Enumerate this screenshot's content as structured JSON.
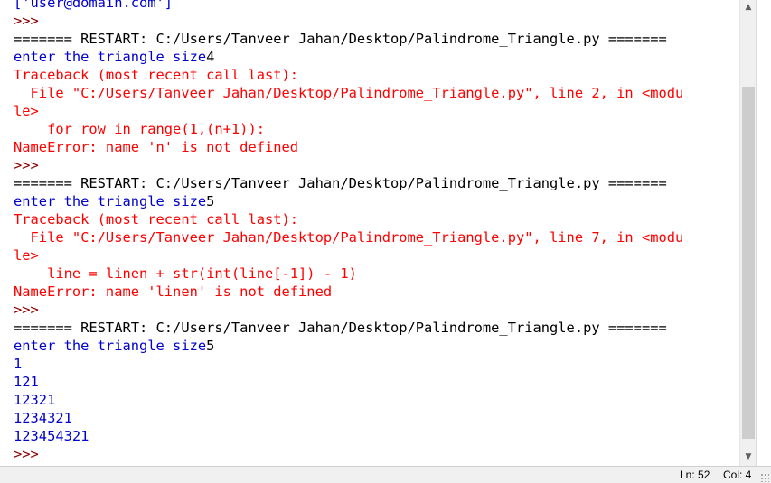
{
  "shell": {
    "lines": [
      [
        {
          "t": "['user@domain.com']",
          "k": "stdout"
        }
      ],
      [
        {
          "t": ">>> ",
          "k": "prompt"
        }
      ],
      [
        {
          "t": "======= RESTART: C:/Users/Tanveer Jahan/Desktop/Palindrome_Triangle.py =======",
          "k": "restart"
        }
      ],
      [
        {
          "t": "enter the triangle size",
          "k": "prompt-text"
        },
        {
          "t": "4",
          "k": "input"
        }
      ],
      [
        {
          "t": "Traceback (most recent call last):",
          "k": "error"
        }
      ],
      [
        {
          "t": "  File \"C:/Users/Tanveer Jahan/Desktop/Palindrome_Triangle.py\", line 2, in <modu",
          "k": "error"
        }
      ],
      [
        {
          "t": "le>",
          "k": "error"
        }
      ],
      [
        {
          "t": "    for row in range(1,(n+1)):",
          "k": "error"
        }
      ],
      [
        {
          "t": "NameError: name 'n' is not defined",
          "k": "error"
        }
      ],
      [
        {
          "t": ">>> ",
          "k": "prompt"
        }
      ],
      [
        {
          "t": "======= RESTART: C:/Users/Tanveer Jahan/Desktop/Palindrome_Triangle.py =======",
          "k": "restart"
        }
      ],
      [
        {
          "t": "enter the triangle size",
          "k": "prompt-text"
        },
        {
          "t": "5",
          "k": "input"
        }
      ],
      [
        {
          "t": "Traceback (most recent call last):",
          "k": "error"
        }
      ],
      [
        {
          "t": "  File \"C:/Users/Tanveer Jahan/Desktop/Palindrome_Triangle.py\", line 7, in <modu",
          "k": "error"
        }
      ],
      [
        {
          "t": "le>",
          "k": "error"
        }
      ],
      [
        {
          "t": "    line = linen + str(int(line[-1]) - 1)",
          "k": "error"
        }
      ],
      [
        {
          "t": "NameError: name 'linen' is not defined",
          "k": "error"
        }
      ],
      [
        {
          "t": ">>> ",
          "k": "prompt"
        }
      ],
      [
        {
          "t": "======= RESTART: C:/Users/Tanveer Jahan/Desktop/Palindrome_Triangle.py =======",
          "k": "restart"
        }
      ],
      [
        {
          "t": "enter the triangle size",
          "k": "prompt-text"
        },
        {
          "t": "5",
          "k": "input"
        }
      ],
      [
        {
          "t": "1",
          "k": "stdout"
        }
      ],
      [
        {
          "t": "121",
          "k": "stdout"
        }
      ],
      [
        {
          "t": "12321",
          "k": "stdout"
        }
      ],
      [
        {
          "t": "1234321",
          "k": "stdout"
        }
      ],
      [
        {
          "t": "123454321",
          "k": "stdout"
        }
      ],
      [
        {
          "t": ">>> ",
          "k": "prompt"
        }
      ]
    ]
  },
  "scrollbar": {
    "up_icon": "chevron-up-icon",
    "down_icon": "chevron-down-icon"
  },
  "statusbar": {
    "ln": "Ln: 52",
    "col": "Col: 4"
  }
}
